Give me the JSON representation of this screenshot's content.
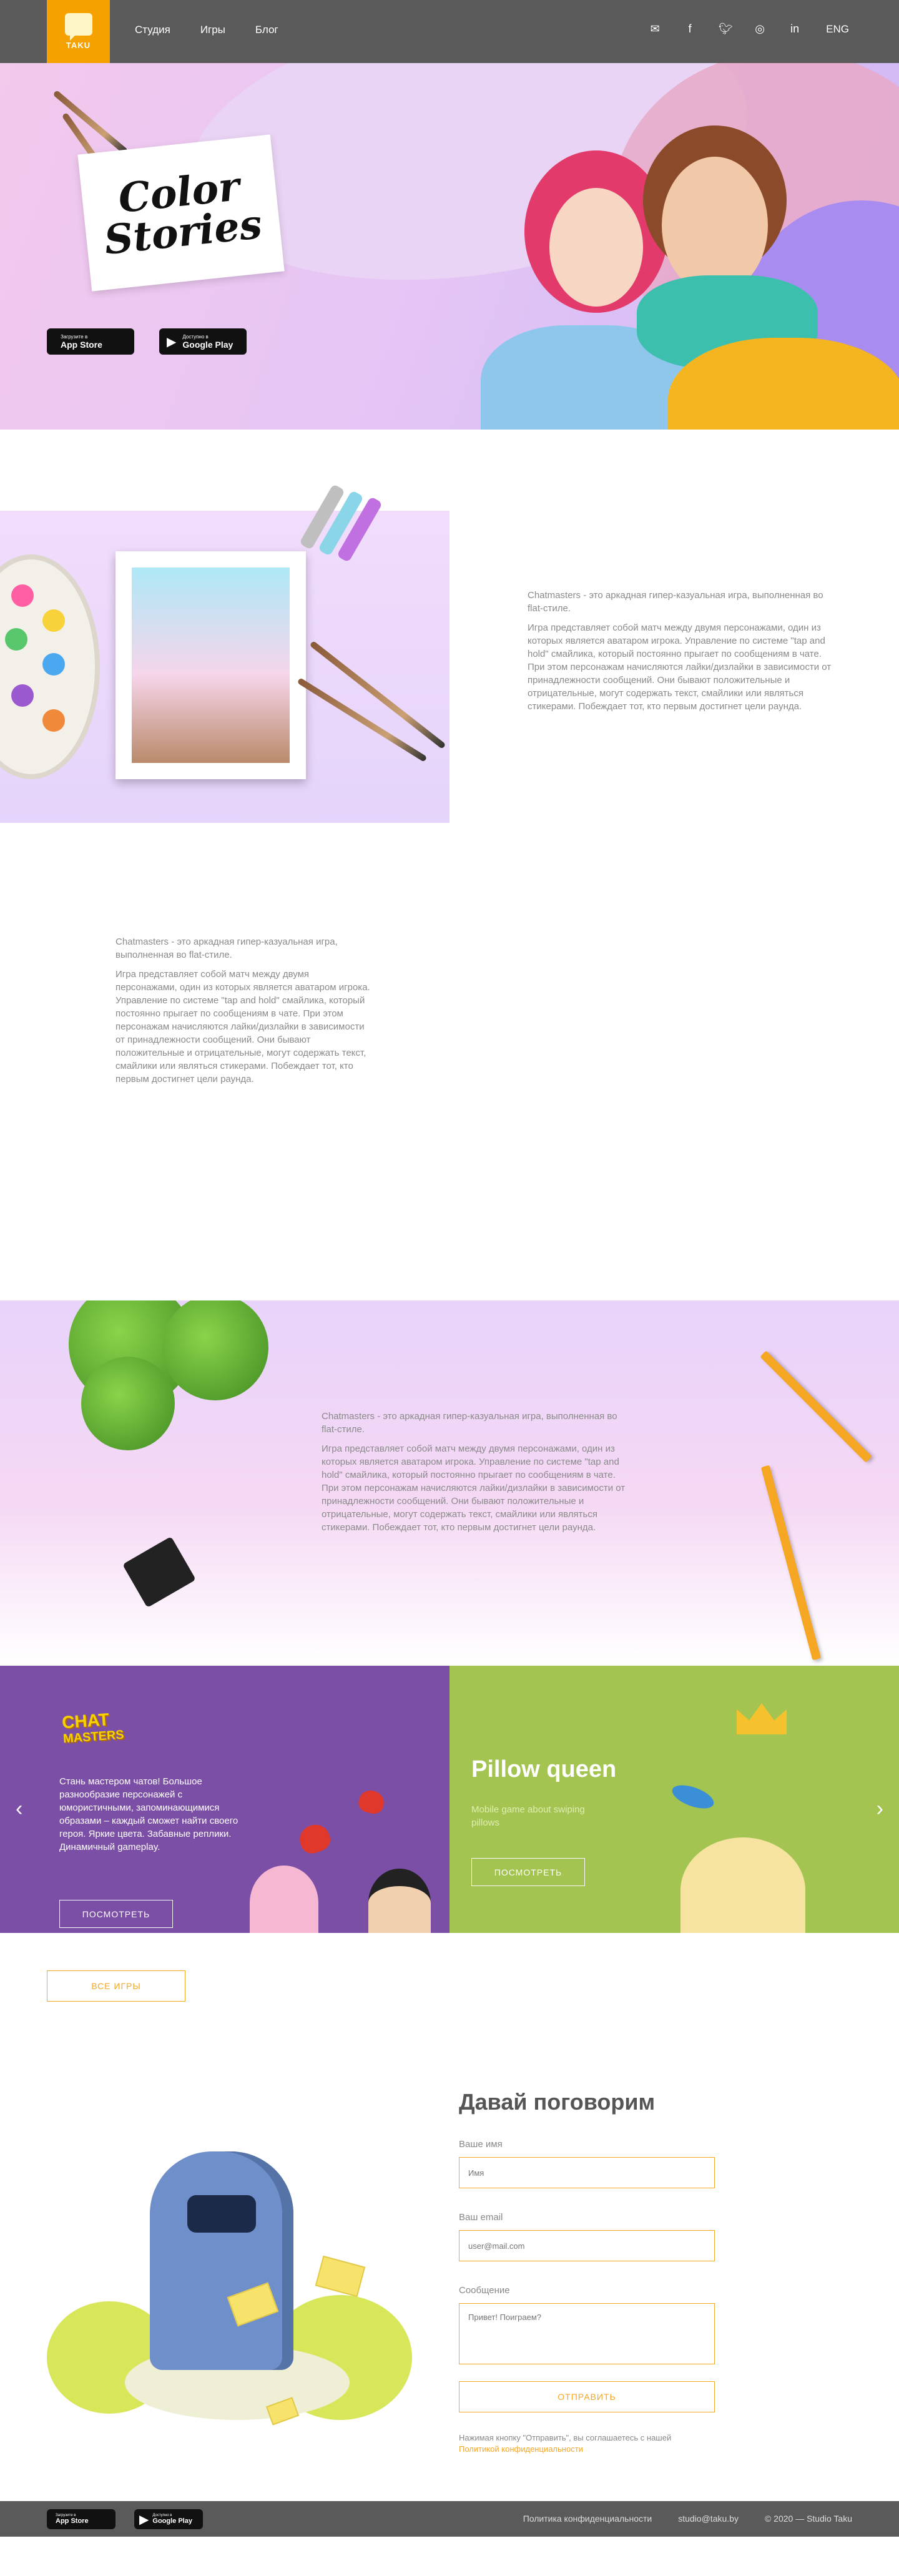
{
  "nav": {
    "logo_text": "TAKU",
    "links": [
      "Студия",
      "Игры",
      "Блог"
    ],
    "icons": [
      "mail-icon",
      "facebook-icon",
      "twitter-icon",
      "instagram-icon",
      "linkedin-icon"
    ],
    "lang": "ENG"
  },
  "hero": {
    "title_line1": "Color",
    "title_line2": "Stories",
    "appstore_small": "Загрузите в",
    "appstore_big": "App Store",
    "googleplay_small": "Доступно в",
    "googleplay_big": "Google Play"
  },
  "sections": {
    "lead": "Chatmasters - это аркадная гипер-казуальная игра, выполненная во flat-стиле.",
    "body": "Игра представляет собой матч между двумя персонажами, один из которых является аватаром игрока. Управление по системе \"tap and hold\" смайлика, который постоянно прыгает по сообщениям в чате. При этом персонажам начисляются лайки/дизлайки в зависимости от принадлежности сообщений. Они бывают положительные и отрицательные, могут содержать текст, смайлики или являться стикерами. Побеждает тот, кто первым достигнет цели раунда."
  },
  "slider": {
    "chat_logo_1": "CHAT",
    "chat_logo_2": "MASTERS",
    "chat_desc": "Стань мастером чатов! Большое разнообразие персонажей с юмористичными, запоминающимися образами – каждый сможет найти своего героя. Яркие цвета. Забавные реплики. Динамичный gameplay.",
    "pq_title": "Pillow queen",
    "pq_desc": "Mobile game about swiping pillows",
    "view_btn": "ПОСМОТРЕТЬ",
    "prev": "‹",
    "next": "›"
  },
  "all_games": "ВСЕ ИГРЫ",
  "contact": {
    "title": "Давай поговорим",
    "name_label": "Ваше имя",
    "name_placeholder": "Имя",
    "email_label": "Ваш email",
    "email_placeholder": "user@mail.com",
    "message_label": "Сообщение",
    "message_placeholder": "Привет! Поиграем?",
    "send": "ОТПРАВИТЬ",
    "note": "Нажимая кнопку \"Отправить\", вы соглашаетесь с нашей",
    "note_link": "Политикой конфиденциальности"
  },
  "footer": {
    "appstore_small": "Загрузите в",
    "appstore_big": "App Store",
    "googleplay_small": "Доступно в",
    "googleplay_big": "Google Play",
    "privacy": "Политика конфиденциальности",
    "email": "studio@taku.by",
    "copyright": "© 2020 — Studio Taku"
  }
}
